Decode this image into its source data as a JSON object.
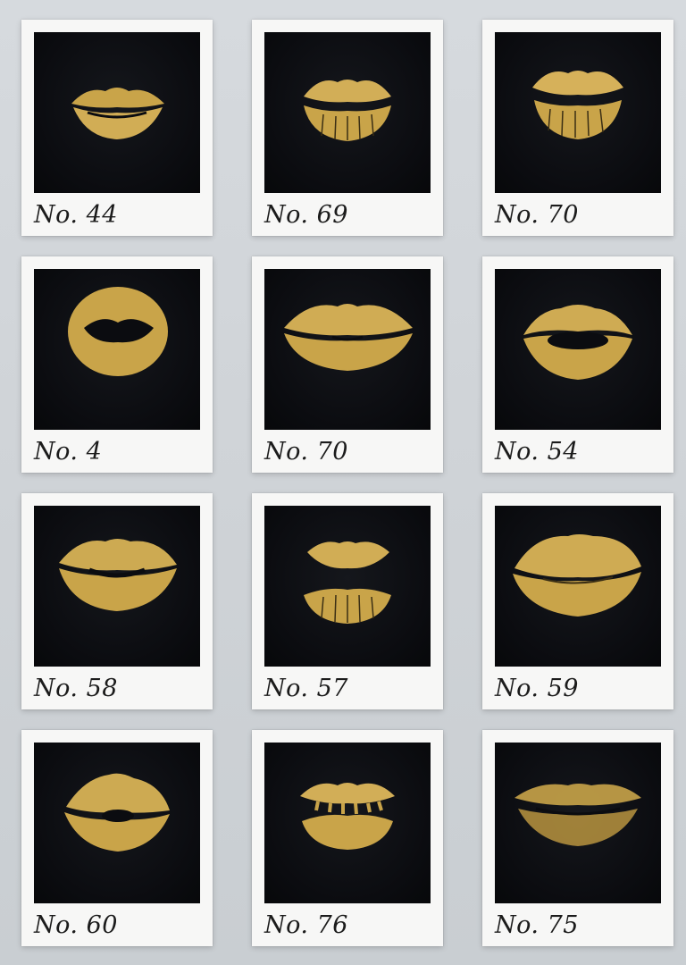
{
  "colors": {
    "gold": "#c9a449",
    "gold_light": "#e2c06a",
    "gold_dark": "#9c7a2c",
    "photo_bg": "#0b0c10",
    "card": "#f7f7f6",
    "wall": "#d2d6da"
  },
  "cards": [
    {
      "caption": "No. 44",
      "print_style": "slim-parted"
    },
    {
      "caption": "No. 69",
      "print_style": "full-parted"
    },
    {
      "caption": "No. 70",
      "print_style": "full-parted"
    },
    {
      "caption": "No. 4",
      "print_style": "round-open"
    },
    {
      "caption": "No. 70",
      "print_style": "wide-closed"
    },
    {
      "caption": "No. 54",
      "print_style": "full-open"
    },
    {
      "caption": "No. 58",
      "print_style": "smudged-closed"
    },
    {
      "caption": "No. 57",
      "print_style": "separated"
    },
    {
      "caption": "No. 59",
      "print_style": "blurred-wide"
    },
    {
      "caption": "No. 60",
      "print_style": "small-smudged"
    },
    {
      "caption": "No. 76",
      "print_style": "full-parted"
    },
    {
      "caption": "No. 75",
      "print_style": "faded-wide"
    }
  ]
}
